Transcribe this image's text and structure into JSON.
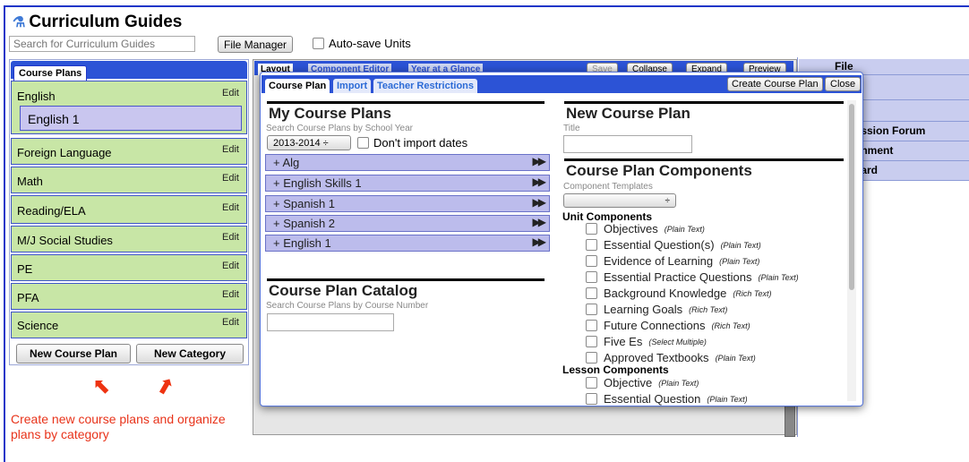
{
  "app": {
    "title": "Curriculum Guides"
  },
  "toolbar": {
    "search_placeholder": "Search for Curriculum Guides",
    "file_manager": "File Manager",
    "autosave": "Auto-save Units"
  },
  "left": {
    "tab": "Course Plans",
    "edit_label": "Edit",
    "categories": [
      "English",
      "Foreign Language",
      "Math",
      "Reading/ELA",
      "M/J Social Studies",
      "PE",
      "PFA",
      "Science"
    ],
    "selected_course": "English 1",
    "new_plan": "New Course Plan",
    "new_category": "New Category",
    "annotation": "Create new course plans and organize plans by category"
  },
  "middle": {
    "tabs": [
      "Layout",
      "Component Editor",
      "Year at a Glance"
    ],
    "buttons": [
      "Save",
      "Collapse",
      "Expand",
      "Preview"
    ]
  },
  "right": {
    "items": [
      "File",
      "",
      "l",
      "ussion Forum",
      "gnment",
      "dard"
    ]
  },
  "modal": {
    "tabs": [
      "Course Plan",
      "Import",
      "Teacher Restrictions"
    ],
    "create_button": "Create Course Plan",
    "close_button": "Close",
    "my_plans": {
      "heading": "My Course Plans",
      "subtitle": "Search Course Plans by School Year",
      "year": "2013-2014 ÷",
      "dont_import": "Don't import dates",
      "plans": [
        "+ Alg",
        "+ English Skills 1",
        "+ Spanish 1",
        "+ Spanish 2",
        "+ English 1"
      ],
      "go_icon": "▶▶"
    },
    "catalog": {
      "heading": "Course Plan Catalog",
      "subtitle": "Search Course Plans by Course Number"
    },
    "new_plan": {
      "heading": "New Course Plan",
      "title_label": "Title"
    },
    "components": {
      "heading": "Course Plan Components",
      "templates_label": "Component Templates",
      "unit_heading": "Unit Components",
      "unit": [
        {
          "name": "Objectives",
          "type": "(Plain Text)"
        },
        {
          "name": "Essential Question(s)",
          "type": "(Plain Text)"
        },
        {
          "name": "Evidence of Learning",
          "type": "(Plain Text)"
        },
        {
          "name": "Essential Practice Questions",
          "type": "(Plain Text)"
        },
        {
          "name": "Background Knowledge",
          "type": "(Rich Text)"
        },
        {
          "name": "Learning Goals",
          "type": "(Rich Text)"
        },
        {
          "name": "Future Connections",
          "type": "(Rich Text)"
        },
        {
          "name": "Five Es",
          "type": "(Select Multiple)"
        },
        {
          "name": "Approved Textbooks",
          "type": "(Plain Text)"
        }
      ],
      "lesson_heading": "Lesson Components",
      "lesson": [
        {
          "name": "Objective",
          "type": "(Plain Text)"
        },
        {
          "name": "Essential Question",
          "type": "(Plain Text)"
        }
      ]
    }
  }
}
